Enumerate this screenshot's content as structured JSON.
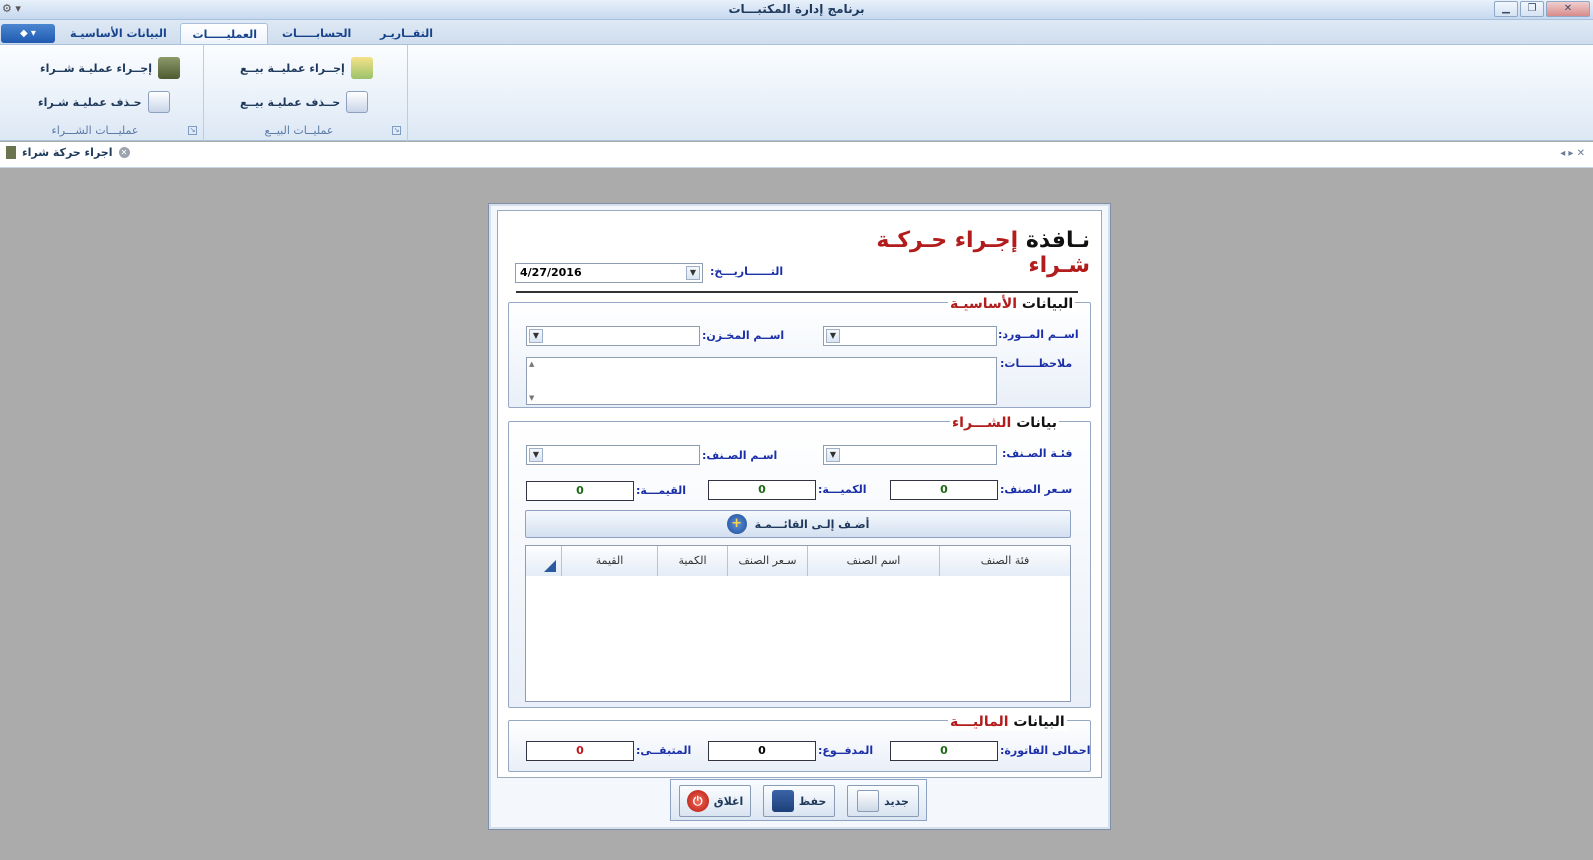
{
  "window": {
    "title": "برنامج إدارة المكتبـــات"
  },
  "ribbon": {
    "tabs": [
      {
        "label": "التقــاريـر"
      },
      {
        "label": "الحسابـــــات"
      },
      {
        "label": "العمليـــــات"
      },
      {
        "label": "البيانات الأساسيـة"
      }
    ],
    "sales_group": {
      "label": "عمليــات البيــع",
      "do_sale": "إجــراء عمليــة بيــع",
      "delete_sale": "حــذف عمليـة بيــع"
    },
    "purchase_group": {
      "label": "عمليـــات الشـــراء",
      "do_purchase": "إجــراء عمليـة شــراء",
      "delete_purchase": "حـذف عمليـة شـراء"
    }
  },
  "doc_tab": {
    "label": "اجراء حركة شراء"
  },
  "form": {
    "title_word1": "نـافذة",
    "title_word2": "إجـراء",
    "title_word3": "حـركـة",
    "title_word4": "شـراء",
    "date_label": "التــــــاريـــخ:",
    "date_value": "4/27/2016",
    "basic": {
      "title_a": "البيانات",
      "title_b": "الأساسيـة",
      "supplier_label": "اســم المــورد:",
      "warehouse_label": "اســم المخـزن:",
      "notes_label": "ملاحظـــــات:"
    },
    "purchase": {
      "title_a": "بيانات",
      "title_b": "الشـــراء",
      "category_label": "فئـة الصـنف:",
      "item_label": "اسـم الصـنف:",
      "price_label": "سـعر الصنف:",
      "price_value": "0",
      "qty_label": "الكميـــة:",
      "qty_value": "0",
      "value_label": "القيمـــة:",
      "value_value": "0",
      "add_button": "أضـف إلـى القائـــمـة",
      "columns": [
        "فئة الصنف",
        "اسم الصنف",
        "سـعر الصنف",
        "الكمية",
        "القيمة"
      ]
    },
    "financial": {
      "title_a": "البيانات",
      "title_b": "الماليـــة",
      "total_label": "احمالى الفاتورة:",
      "total_value": "0",
      "paid_label": "المدفــوع:",
      "paid_value": "0",
      "remaining_label": "المتبقــى:",
      "remaining_value": "0"
    },
    "buttons": {
      "new": "جديد",
      "save": "حفظ",
      "close": "اغلاق"
    }
  },
  "colors": {
    "accent_red": "#b21c1c",
    "label_blue": "#1a2fa8",
    "value_green": "#1b6a12"
  }
}
